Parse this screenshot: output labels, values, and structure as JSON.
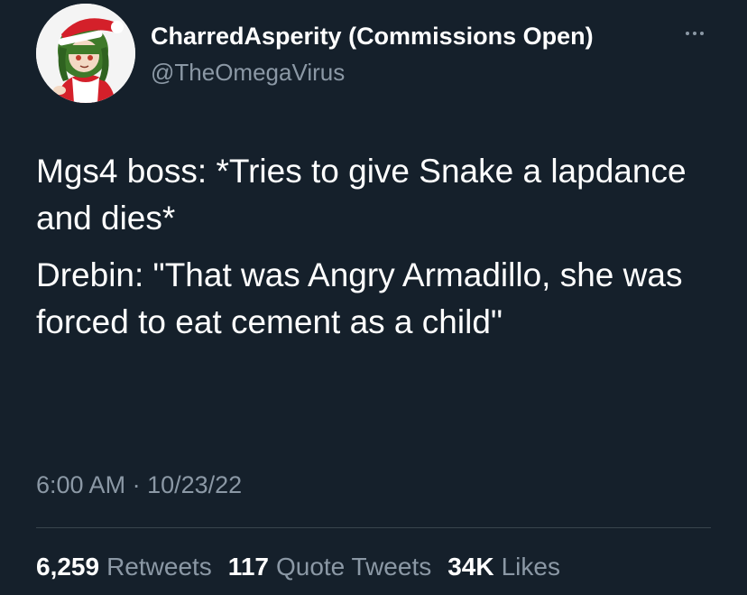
{
  "author": {
    "display_name": "CharredAsperity (Commissions Open)",
    "handle": "@TheOmegaVirus",
    "more_icon": "more-horizontal-icon"
  },
  "tweet": {
    "paragraphs": [
      "Mgs4 boss: *Tries to give Snake a lapdance and dies*",
      "Drebin: \"That was Angry Armadillo, she was forced to eat cement as a child\""
    ]
  },
  "meta": {
    "time": "6:00 AM",
    "separator": "·",
    "date": "10/23/22"
  },
  "stats": [
    {
      "count": "6,259",
      "label": "Retweets"
    },
    {
      "count": "117",
      "label": "Quote Tweets"
    },
    {
      "count": "34K",
      "label": "Likes"
    }
  ],
  "colors": {
    "background": "#15202b",
    "text": "#ffffff",
    "secondary": "#8b98a5",
    "divider": "#38444d"
  }
}
